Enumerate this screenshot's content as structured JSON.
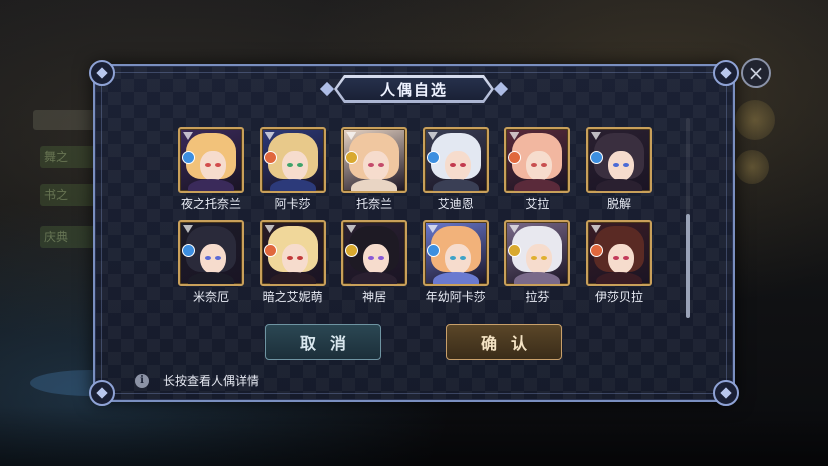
{
  "modal": {
    "title": "人偶自选",
    "close_glyph": "×",
    "cancel_label": "取消",
    "confirm_label": "确认",
    "info_text": "长按查看人偶详情",
    "info_glyph": "i"
  },
  "background": {
    "menu_items": [
      "舞之",
      "书之",
      "庆典"
    ]
  },
  "dolls": [
    {
      "name": "夜之托奈兰",
      "element": "water",
      "badge_color": "#3d8fe0",
      "hair": "#f2c27a",
      "eyes": "#d24c4c",
      "outfit": "#3a2a5a"
    },
    {
      "name": "阿卡莎",
      "element": "fire",
      "badge_color": "#e0683d",
      "hair": "#e8c98a",
      "eyes": "#3fa36a",
      "outfit": "#2c3a7a"
    },
    {
      "name": "托奈兰",
      "element": "light",
      "badge_color": "#d9a92f",
      "hair": "#f0c7a0",
      "eyes": "#c44b6b",
      "outfit": "#e9d5c4"
    },
    {
      "name": "艾迪恩",
      "element": "water",
      "badge_color": "#3d8fe0",
      "hair": "#e3e8f2",
      "eyes": "#c23a4e",
      "outfit": "#3a3f55"
    },
    {
      "name": "艾拉",
      "element": "fire",
      "badge_color": "#e0683d",
      "hair": "#f2b7a0",
      "eyes": "#c84f4f",
      "outfit": "#5a2a3a"
    },
    {
      "name": "脱解",
      "element": "water",
      "badge_color": "#3d8fe0",
      "hair": "#3a2f3f",
      "eyes": "#4b6bd6",
      "outfit": "#2a2030"
    },
    {
      "name": "米奈厄",
      "element": "water",
      "badge_color": "#3d8fe0",
      "hair": "#2a2a3a",
      "eyes": "#5a6ad6",
      "outfit": "#1c1c28"
    },
    {
      "name": "暗之艾妮萌",
      "element": "fire",
      "badge_color": "#e0683d",
      "hair": "#f0d79a",
      "eyes": "#c23a3a",
      "outfit": "#2a1c24"
    },
    {
      "name": "神居",
      "element": "light",
      "badge_color": "#d9a92f",
      "hair": "#1e1a24",
      "eyes": "#8a5ad6",
      "outfit": "#2a2030"
    },
    {
      "name": "年幼阿卡莎",
      "element": "water",
      "badge_color": "#3d8fe0",
      "hair": "#f2b27a",
      "eyes": "#3fa3c8",
      "outfit": "#6a7ad0"
    },
    {
      "name": "拉芬",
      "element": "light",
      "badge_color": "#d9a92f",
      "hair": "#e8e8ef",
      "eyes": "#e0b030",
      "outfit": "#7a6a8a"
    },
    {
      "name": "伊莎贝拉",
      "element": "fire",
      "badge_color": "#e0683d",
      "hair": "#5a2a24",
      "eyes": "#c23a5a",
      "outfit": "#3a1c24"
    }
  ],
  "colors": {
    "accent_frame": "#7a8fc0",
    "cancel_button": "#2b4753",
    "confirm_button": "#5a4628",
    "portrait_border": "#c9a05a"
  }
}
